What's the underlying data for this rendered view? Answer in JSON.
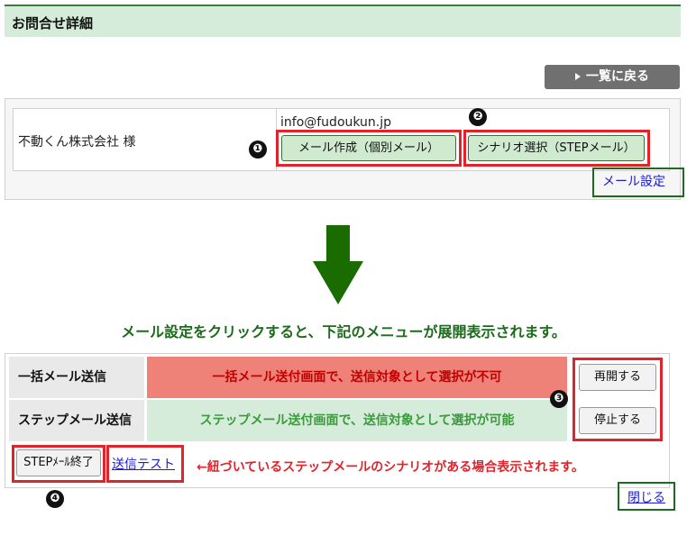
{
  "header": {
    "title": "お問合せ詳細"
  },
  "back_button": {
    "label": "一覧に戻る"
  },
  "customer": {
    "company": "不動くん株式会社 様",
    "email": "info@fudoukun.jp"
  },
  "buttons": {
    "mail_create": "メール作成（個別メール）",
    "scenario_select": "シナリオ選択（STEPメール）"
  },
  "markers": [
    "❶",
    "❷",
    "❸",
    "❹"
  ],
  "mail_settings_link": "メール設定",
  "caption": "メール設定をクリックすると、下記のメニューが展開表示されます。",
  "menu": {
    "rows": [
      {
        "label": "一括メール送信",
        "message": "一括メール送付画面で、送信対象として選択が不可",
        "button": "再開する",
        "bg": "#ef8278",
        "text_color": "#c00000"
      },
      {
        "label": "ステップメール送信",
        "message": "ステップメール送付画面で、送信対象として選択が可能",
        "button": "停止する",
        "bg": "#d4ecd9",
        "text_color": "#3c9a3c"
      }
    ],
    "step_end_button": "STEPﾒｰﾙ終了",
    "send_test_link": "送信テスト",
    "note": "←紐づいているステップメールのシナリオがある場合表示されます。",
    "close_link": "閉じる"
  },
  "colors": {
    "red_highlight": "#e0242c",
    "green_highlight": "#1d6b1d",
    "arrow": "#1a6b00"
  }
}
